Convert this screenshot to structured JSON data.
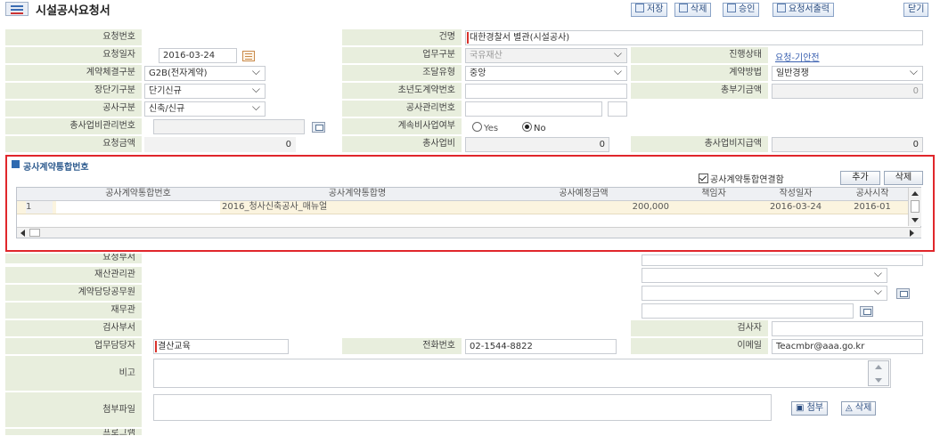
{
  "title": "시설공사요청서",
  "toolbar": {
    "save": "저장",
    "delete": "삭제",
    "approve": "승인",
    "print": "요청서출력",
    "close": "닫기"
  },
  "form": {
    "req_no_label": "요청번호",
    "subject_label": "건명",
    "subject_value": "대한경찰서 별관(시설공사)",
    "req_date_label": "요청일자",
    "req_date_value": "2016-03-24",
    "biz_type_label": "업무구분",
    "biz_type_value": "국유재산",
    "status_label": "진행상태",
    "status_value": "요청-기안전",
    "contract_type_label": "계약체결구분",
    "contract_type_value": "G2B(전자계약)",
    "procure_type_label": "조달유형",
    "procure_type_value": "중앙",
    "contract_method_label": "계약방법",
    "contract_method_value": "일반경쟁",
    "term_label": "장단기구분",
    "term_value": "단기신규",
    "first_year_no_label": "초년도계약번호",
    "total_deposit_label": "총부기금액",
    "total_deposit_value": "0",
    "work_type_label": "공사구분",
    "work_type_value": "신축/신규",
    "work_mgmt_no_label": "공사관리번호",
    "total_biz_mgmt_no_label": "총사업비관리번호",
    "continuing_label": "계속비사업여부",
    "yes_label": "Yes",
    "no_label": "No",
    "req_amount_label": "요청금액",
    "req_amount_value": "0",
    "total_biz_label": "총사업비",
    "total_biz_value": "0",
    "total_biz_pay_label": "총사업비지급액",
    "total_biz_pay_value": "0"
  },
  "section": {
    "title": "공사계약통합번호",
    "merge_check_label": "공사계약통합연결함",
    "add_button": "추가",
    "delete_button": "삭제",
    "columns": [
      "공사계약통합번호",
      "공사계약통합명",
      "공사예정금액",
      "책임자",
      "작성일자",
      "공사시작"
    ],
    "rows": [
      {
        "idx": "1",
        "no": "",
        "name": "2016_청사신축공사_매뉴얼",
        "amount": "200,000",
        "owner": "",
        "date": "2016-03-24",
        "start": "2016-01"
      }
    ]
  },
  "lower": {
    "dept_label": "요청부서",
    "asset_mgr_label": "재산관리관",
    "contract_officer_label": "계약담당공무원",
    "finance_label": "재무관",
    "inspect_dept_label": "검사부서",
    "inspector_label": "검사자",
    "staff_label": "업무담당자",
    "staff_value": "결산교육",
    "phone_label": "전화번호",
    "phone_value": "02-1544-8822",
    "email_label": "이메일",
    "email_value": "Teacmbr@aaa.go.kr",
    "note_label": "비고",
    "attach_label": "첨부파일",
    "attach_button": "첨부",
    "attach_delete": "삭제",
    "program_label": "프로그램"
  }
}
